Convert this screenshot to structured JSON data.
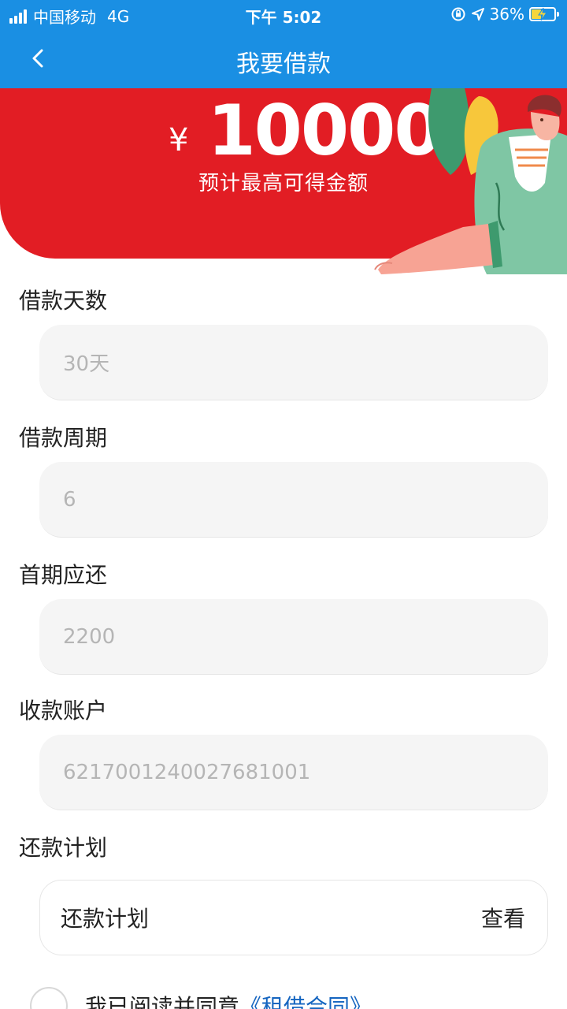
{
  "status_bar": {
    "carrier": "中国移动",
    "network": "4G",
    "time": "下午 5:02",
    "battery": "36%"
  },
  "nav": {
    "title": "我要借款",
    "back_icon": "chevron-left-icon"
  },
  "banner": {
    "currency": "¥",
    "amount": "10000",
    "subtitle": "预计最高可得金额"
  },
  "form": {
    "days": {
      "label": "借款天数",
      "value": "30天"
    },
    "period": {
      "label": "借款周期",
      "value": "6"
    },
    "first_repay": {
      "label": "首期应还",
      "value": "2200"
    },
    "account": {
      "label": "收款账户",
      "value": "6217001240027681001"
    },
    "plan": {
      "label": "还款计划",
      "item_label": "还款计划",
      "action": "查看"
    }
  },
  "agreement": {
    "text": "我已阅读并同意",
    "link": "《租借合同》"
  },
  "colors": {
    "primary": "#1a8fe3",
    "banner": "#e21d24",
    "link": "#1565c0"
  }
}
